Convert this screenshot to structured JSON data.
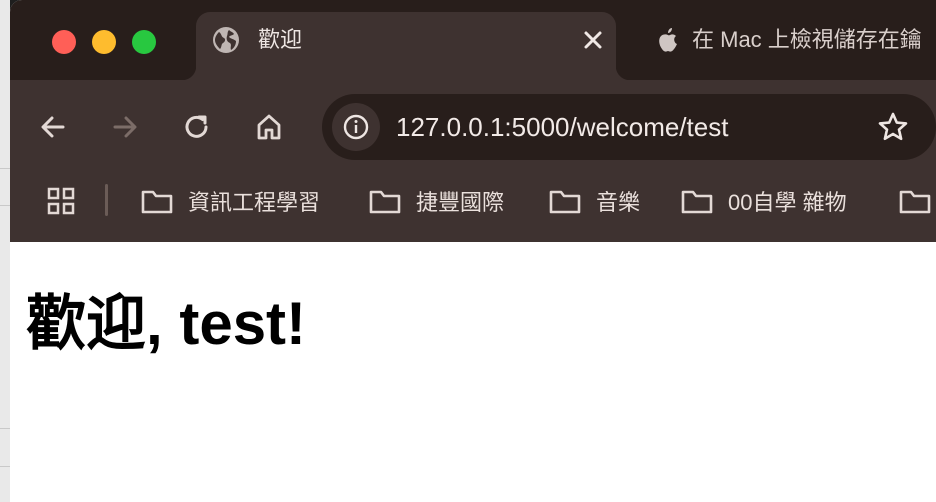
{
  "tabs": [
    {
      "title": "歡迎",
      "active": true,
      "icon": "globe-icon"
    },
    {
      "title": "在 Mac 上檢視儲存在鑰",
      "active": false,
      "icon": "apple-icon"
    }
  ],
  "toolbar": {
    "url": "127.0.0.1:5000/welcome/test"
  },
  "bookmarks": [
    {
      "label": "資訊工程學習",
      "icon": "folder-icon"
    },
    {
      "label": "捷豐國際",
      "icon": "folder-icon"
    },
    {
      "label": "音樂",
      "icon": "folder-icon"
    },
    {
      "label": "00自學 雜物",
      "icon": "folder-icon"
    },
    {
      "label": "",
      "icon": "folder-icon"
    }
  ],
  "page": {
    "heading": "歡迎, test!"
  },
  "colors": {
    "titlebar": "#281e1b",
    "toolbar": "#3e3230",
    "close": "#ff5f57",
    "minimize": "#febc2e",
    "maximize": "#28c840"
  }
}
